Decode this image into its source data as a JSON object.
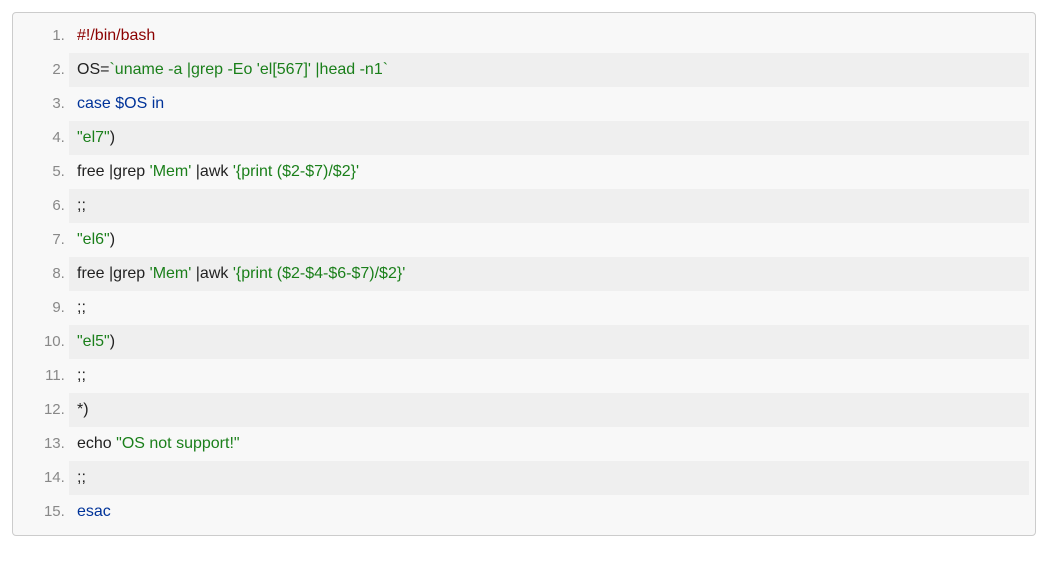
{
  "code": {
    "lines": [
      {
        "tokens": [
          {
            "cls": "tok-shebang",
            "text": "#!/bin/bash"
          }
        ]
      },
      {
        "tokens": [
          {
            "cls": "tok-plain",
            "text": "OS="
          },
          {
            "cls": "tok-string",
            "text": "`uname -a |grep -Eo 'el[567]' |head -n1`"
          }
        ]
      },
      {
        "tokens": [
          {
            "cls": "tok-keyword",
            "text": "case"
          },
          {
            "cls": "tok-plain",
            "text": " "
          },
          {
            "cls": "tok-var",
            "text": "$OS"
          },
          {
            "cls": "tok-plain",
            "text": " "
          },
          {
            "cls": "tok-keyword",
            "text": "in"
          }
        ]
      },
      {
        "tokens": [
          {
            "cls": "tok-string",
            "text": "\"el7\""
          },
          {
            "cls": "tok-plain",
            "text": ")"
          }
        ]
      },
      {
        "tokens": [
          {
            "cls": "tok-plain",
            "text": "free |grep "
          },
          {
            "cls": "tok-string",
            "text": "'Mem'"
          },
          {
            "cls": "tok-plain",
            "text": " |awk "
          },
          {
            "cls": "tok-string",
            "text": "'{print ($2-$7)/$2}'"
          }
        ]
      },
      {
        "tokens": [
          {
            "cls": "tok-plain",
            "text": ";;"
          }
        ]
      },
      {
        "tokens": [
          {
            "cls": "tok-string",
            "text": "\"el6\""
          },
          {
            "cls": "tok-plain",
            "text": ")"
          }
        ]
      },
      {
        "tokens": [
          {
            "cls": "tok-plain",
            "text": "free |grep "
          },
          {
            "cls": "tok-string",
            "text": "'Mem'"
          },
          {
            "cls": "tok-plain",
            "text": " |awk "
          },
          {
            "cls": "tok-string",
            "text": "'{print ($2-$4-$6-$7)/$2}'"
          }
        ]
      },
      {
        "tokens": [
          {
            "cls": "tok-plain",
            "text": ";;"
          }
        ]
      },
      {
        "tokens": [
          {
            "cls": "tok-string",
            "text": "\"el5\""
          },
          {
            "cls": "tok-plain",
            "text": ")"
          }
        ]
      },
      {
        "tokens": [
          {
            "cls": "tok-plain",
            "text": ";;"
          }
        ]
      },
      {
        "tokens": [
          {
            "cls": "tok-plain",
            "text": "*)"
          }
        ]
      },
      {
        "tokens": [
          {
            "cls": "tok-plain",
            "text": "echo "
          },
          {
            "cls": "tok-string",
            "text": "\"OS not support!\""
          }
        ]
      },
      {
        "tokens": [
          {
            "cls": "tok-plain",
            "text": ";;"
          }
        ]
      },
      {
        "tokens": [
          {
            "cls": "tok-keyword",
            "text": "esac"
          }
        ]
      }
    ]
  }
}
